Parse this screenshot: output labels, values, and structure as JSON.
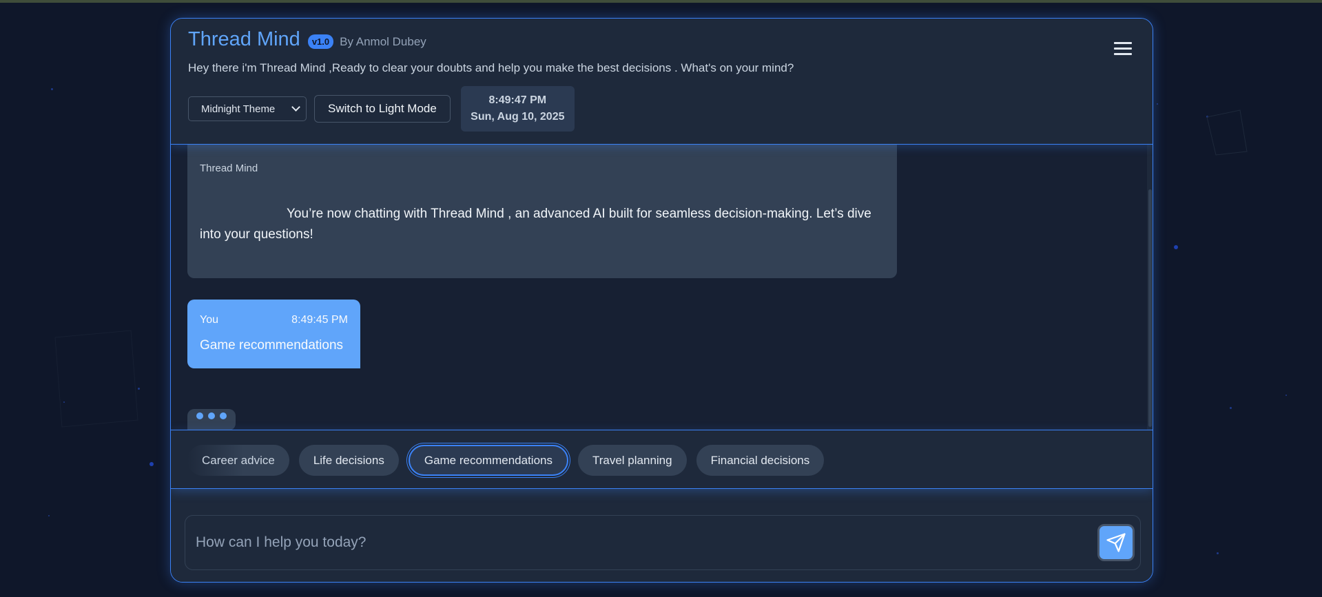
{
  "header": {
    "title": "Thread Mind",
    "version": "v1.0",
    "author": "By Anmol Dubey",
    "subtitle": "Hey there i'm Thread Mind ,Ready to clear your doubts and help you make the best decisions . What's on your mind?",
    "theme_select": "Midnight Theme",
    "light_mode_label": "Switch to Light Mode",
    "clock_time": "8:49:47 PM",
    "clock_date": "Sun, Aug 10, 2025"
  },
  "chat": {
    "bot_name": "Thread Mind",
    "bot_text": "You’re now chatting with Thread Mind , an advanced AI built for seamless decision-making. Let’s dive into your questions!",
    "user_name": "You",
    "user_time": "8:49:45 PM",
    "user_text": "Game recommendations"
  },
  "suggestions": [
    "Career advice",
    "Life decisions",
    "Game recommendations",
    "Travel planning",
    "Financial decisions"
  ],
  "input": {
    "placeholder": "How can I help you today?"
  },
  "icons": {
    "menu": "hamburger-icon",
    "send": "send-icon",
    "dropdown": "chevron-down-icon"
  },
  "colors": {
    "accent": "#60a5fa",
    "border": "#3b82f6",
    "background": "#0f172a",
    "panel": "#1e293b"
  }
}
